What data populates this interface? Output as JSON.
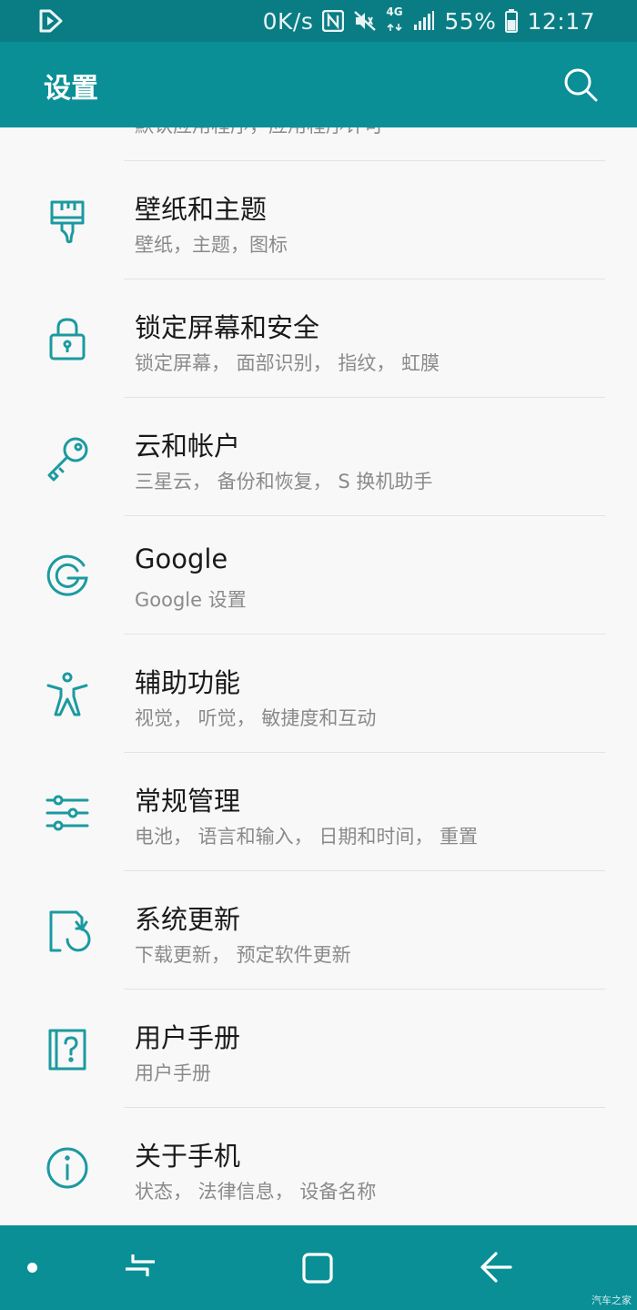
{
  "status_bar": {
    "network_speed": "0K/s",
    "network_type": "4G",
    "battery": "55%",
    "time": "12:17",
    "icons": [
      "play-app-icon",
      "nfc-icon",
      "mute-vibrate-icon",
      "data-arrows-icon",
      "signal-icon",
      "battery-icon"
    ]
  },
  "app_bar": {
    "title": "设置",
    "search_icon": "search-icon"
  },
  "list": {
    "partial_item_subtitle": "默认应用程序，应用程序许可",
    "items": [
      {
        "title": "壁纸和主题",
        "subtitle": "壁纸，主题，图标",
        "icon": "paintbrush-icon"
      },
      {
        "title": "锁定屏幕和安全",
        "subtitle": "锁定屏幕， 面部识别， 指纹， 虹膜",
        "icon": "lock-icon"
      },
      {
        "title": "云和帐户",
        "subtitle": "三星云， 备份和恢复， S 换机助手",
        "icon": "key-icon"
      },
      {
        "title": "Google",
        "subtitle": "Google 设置",
        "icon": "google-icon"
      },
      {
        "title": "辅助功能",
        "subtitle": "视觉， 听觉， 敏捷度和互动",
        "icon": "accessibility-icon"
      },
      {
        "title": "常规管理",
        "subtitle": "电池， 语言和输入， 日期和时间， 重置",
        "icon": "sliders-icon"
      },
      {
        "title": "系统更新",
        "subtitle": "下载更新， 预定软件更新",
        "icon": "system-update-icon"
      },
      {
        "title": "用户手册",
        "subtitle": "用户手册",
        "icon": "user-manual-icon"
      },
      {
        "title": "关于手机",
        "subtitle": "状态， 法律信息， 设备名称",
        "icon": "info-icon"
      }
    ]
  },
  "nav_bar": {
    "icons": [
      "nav-dot-icon",
      "recents-icon",
      "home-icon",
      "back-icon"
    ],
    "watermark": "汽车之家"
  },
  "colors": {
    "status_bar": "#0a7d84",
    "app_bar": "#0a8f96",
    "accent_icon": "#1b9aa0",
    "background": "#f8f8f8",
    "title_text": "#1a1a1a",
    "subtitle_text": "#8a8a8a"
  }
}
